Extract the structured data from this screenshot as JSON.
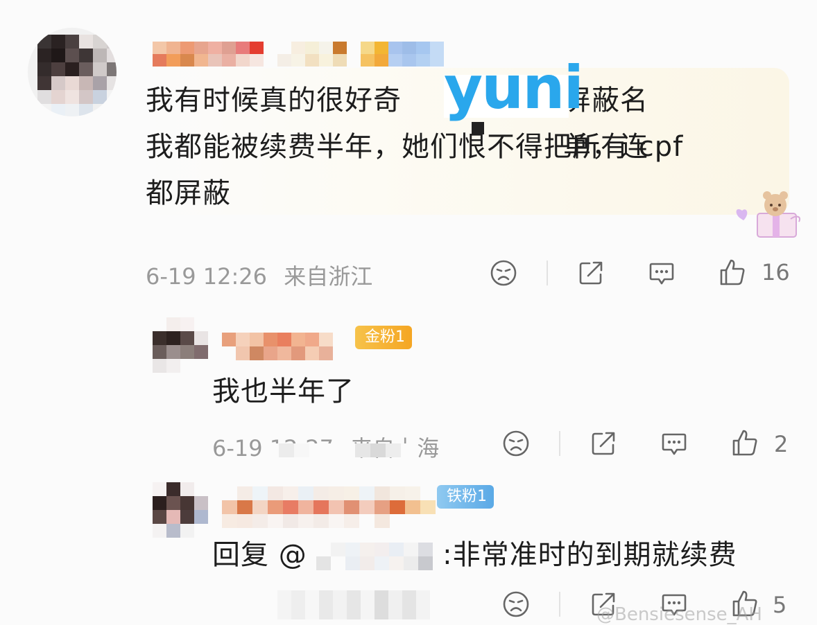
{
  "main_comment": {
    "text_lines": [
      "我有时候真的很好奇",
      "屏蔽名单，连",
      "我都能被续费半年，她们恨不得把所有 cpf",
      "都屏蔽"
    ],
    "overlay_text": "yuni",
    "timestamp": "6-19 12:26",
    "location": "来自浙江",
    "like_count": "16"
  },
  "replies": [
    {
      "badge": "金粉1",
      "text": "我也半年了",
      "timestamp": "6-19 12:27",
      "location": "来自上海",
      "like_count": "2"
    },
    {
      "badge": "铁粉1",
      "prefix": "回复 @",
      "text": ":非常准时的到期就续费",
      "like_count": "5"
    }
  ],
  "watermark": "@Bensiesense_AH",
  "colors": {
    "accent_blue": "#2aa7ec",
    "badge_gold": "#f5a623",
    "badge_blue": "#5aa9e6",
    "meta_gray": "#999999"
  },
  "icons": [
    "dislike-face-icon",
    "share-icon",
    "comment-icon",
    "thumbs-up-icon"
  ]
}
